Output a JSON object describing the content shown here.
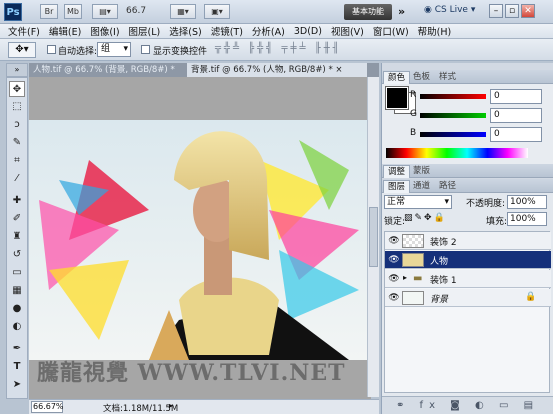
{
  "appbar": {
    "logo": "Ps",
    "br": "Br",
    "mb": "Mb",
    "zoom": "66.7",
    "workspace": "基本功能",
    "more": "»",
    "cslive": "CS Live"
  },
  "menu": [
    "文件(F)",
    "编辑(E)",
    "图像(I)",
    "图层(L)",
    "选择(S)",
    "滤镜(T)",
    "分析(A)",
    "3D(D)",
    "视图(V)",
    "窗口(W)",
    "帮助(H)"
  ],
  "options": {
    "auto_select_label": "自动选择:",
    "auto_select_value": "组",
    "show_transform_label": "显示变换控件"
  },
  "doc_tabs": [
    "人物.tif @ 66.7% (背景, RGB/8#) *",
    "背景.tif @ 66.7% (人物, RGB/8#) *"
  ],
  "status": {
    "zoom": "66.67%",
    "doc": "文档:1.18M/11.5M"
  },
  "watermark": "騰龍視覺 WWW.TLVI.NET",
  "color_panel": {
    "tabs": [
      "颜色",
      "色板",
      "样式"
    ],
    "r_label": "R",
    "g_label": "G",
    "b_label": "B"
  },
  "adjust_tabs": [
    "调整",
    "蒙版"
  ],
  "layers_panel": {
    "tabs": [
      "图层",
      "通道",
      "路径"
    ],
    "blend_mode": "正常",
    "opacity_label": "不透明度:",
    "opacity": "100%",
    "lock_label": "锁定:",
    "fill_label": "填充:",
    "fill": "100%",
    "layers": [
      {
        "name": "装饰 2",
        "selected": false
      },
      {
        "name": "人物",
        "selected": true
      },
      {
        "name": "装饰 1",
        "selected": false,
        "group": true
      },
      {
        "name": "背景",
        "selected": false,
        "locked": true
      }
    ]
  },
  "colors": {
    "accent": "#15307a",
    "foreground": "#000000",
    "background": "#ffffff"
  }
}
